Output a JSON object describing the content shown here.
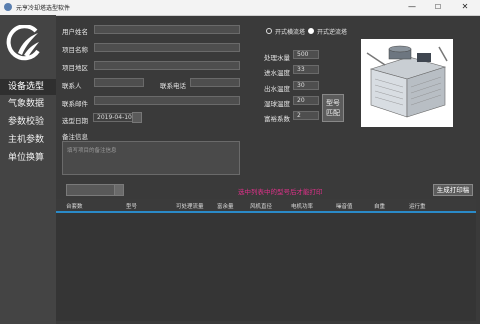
{
  "window": {
    "title": "元亨冷却塔选型软件",
    "minimize": "—",
    "maximize": "☐",
    "close": "✕"
  },
  "sidebar": {
    "items": [
      "设备选型",
      "气象数据",
      "参数校验",
      "主机参数",
      "单位换算"
    ]
  },
  "form": {
    "user_name_label": "用户姓名",
    "project_name_label": "项目名称",
    "project_region_label": "项目地区",
    "contact_label": "联系人",
    "phone_label": "联系电话",
    "email_label": "联系邮件",
    "date_label": "选型日期",
    "date_value": "2019-04-10",
    "note_label": "备注信息",
    "note_placeholder": "填写项目的备注信息"
  },
  "params": {
    "radio_closed": "开式横流塔",
    "radio_open": "开式逆流塔",
    "flow_label": "处理水量",
    "flow_value": "500",
    "inlet_label": "进水温度",
    "inlet_value": "33",
    "outlet_label": "出水温度",
    "outlet_value": "30",
    "wetbulb_label": "湿球温度",
    "wetbulb_value": "20",
    "coef_label": "富裕系数",
    "coef_value": "2",
    "match_button": "型号\n匹配"
  },
  "bottom": {
    "hint": "选中列表中的型号后才能打印",
    "print_button": "生成打印稿",
    "columns": [
      "台套数",
      "型号",
      "可处理流量",
      "富余量",
      "风机直径",
      "电机功率",
      "噪音值",
      "自重",
      "运行重"
    ]
  },
  "colors": {
    "accent": "#2a8ac8",
    "hint": "#e0308a"
  }
}
